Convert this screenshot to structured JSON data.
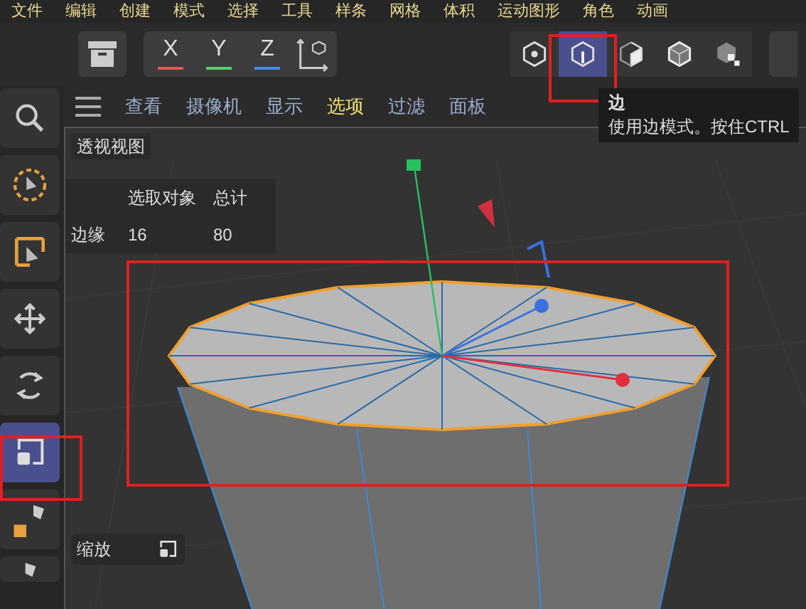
{
  "menu_bar": [
    "文件",
    "编辑",
    "创建",
    "模式",
    "选择",
    "工具",
    "样条",
    "网格",
    "体积",
    "运动图形",
    "角色",
    "动画"
  ],
  "toolbar": {
    "axis_buttons": [
      {
        "label": "X",
        "color": "#e05a5a"
      },
      {
        "label": "Y",
        "color": "#5ad06a"
      },
      {
        "label": "Z",
        "color": "#4a8ae8"
      }
    ],
    "mode_buttons": [
      {
        "kind": "points",
        "selected": false
      },
      {
        "kind": "edges",
        "selected": true
      },
      {
        "kind": "polygons",
        "selected": false
      },
      {
        "kind": "model",
        "selected": false
      },
      {
        "kind": "texture",
        "selected": false
      }
    ]
  },
  "tools": [
    {
      "kind": "zoom",
      "selected": false
    },
    {
      "kind": "live_selection",
      "selected": false
    },
    {
      "kind": "rect_selection",
      "selected": false
    },
    {
      "kind": "move",
      "selected": false
    },
    {
      "kind": "rotate",
      "selected": false
    },
    {
      "kind": "scale",
      "selected": true
    },
    {
      "kind": "pen",
      "selected": false
    },
    {
      "kind": "pen2",
      "selected": false
    }
  ],
  "viewport": {
    "menu": [
      {
        "label": "查看",
        "selected": false
      },
      {
        "label": "摄像机",
        "selected": false
      },
      {
        "label": "显示",
        "selected": false
      },
      {
        "label": "选项",
        "selected": true
      },
      {
        "label": "过滤",
        "selected": false
      },
      {
        "label": "面板",
        "selected": false
      }
    ],
    "title": "透视视图",
    "stats": {
      "headers": [
        "选取对象",
        "总计"
      ],
      "rows": [
        {
          "label": "边缘",
          "values": [
            "16",
            "80"
          ]
        }
      ]
    },
    "hud_label": "缩放",
    "tooltip": {
      "title": "边",
      "text": "使用边模式。按住CTRL"
    }
  }
}
